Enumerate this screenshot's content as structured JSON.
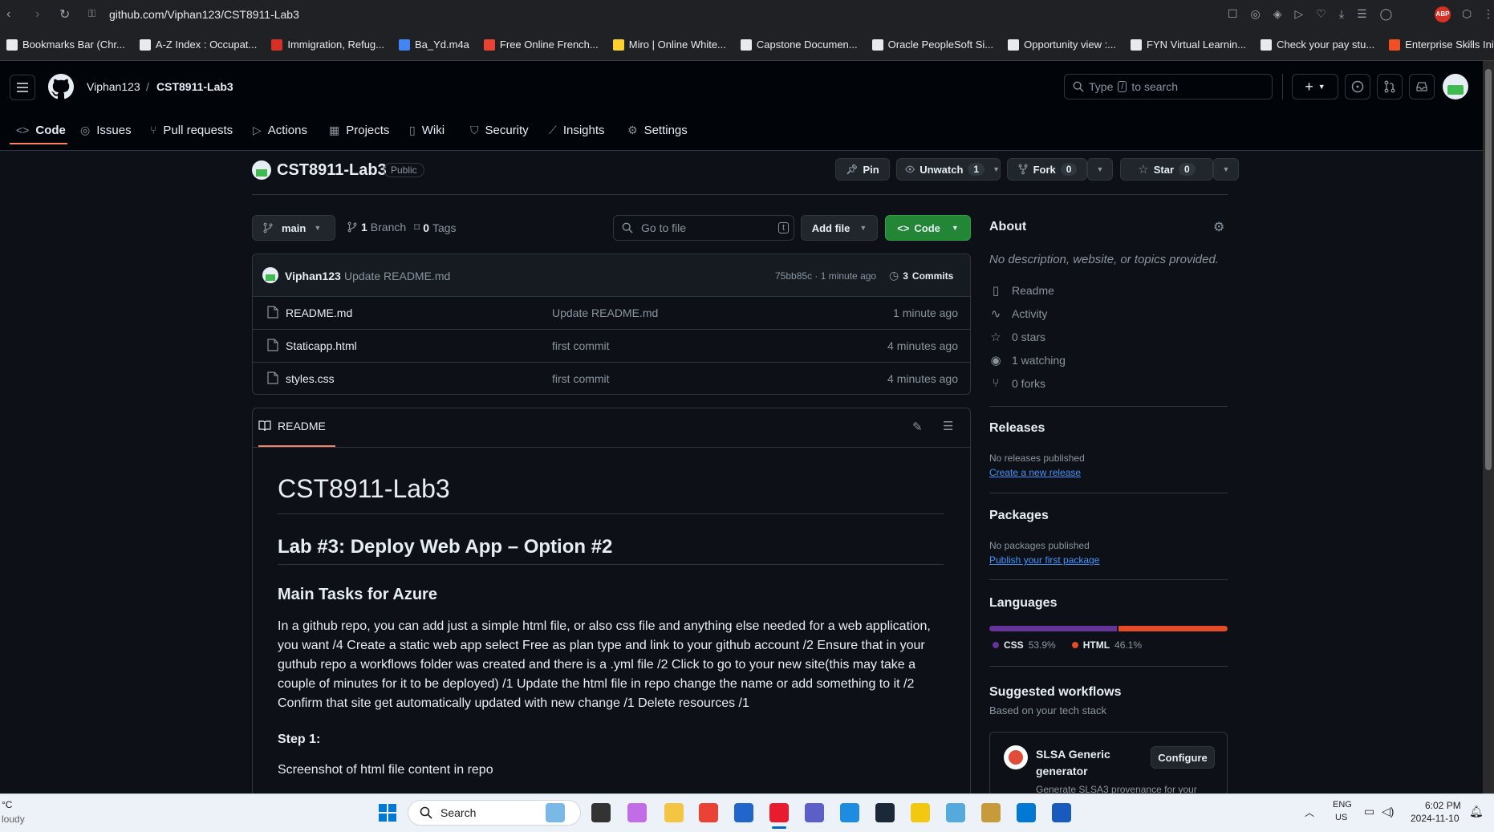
{
  "browser": {
    "url": "github.com/Viphan123/CST8911-Lab3",
    "bookmarks": [
      {
        "label": "Bookmarks Bar (Chr...",
        "color": "#e8eaed"
      },
      {
        "label": "A-Z Index : Occupat...",
        "color": "#e8eaed"
      },
      {
        "label": "Immigration, Refug...",
        "color": "#d93025"
      },
      {
        "label": "Ba_Yd.m4a",
        "color": "#4285f4"
      },
      {
        "label": "Free Online French...",
        "color": "#ea4335"
      },
      {
        "label": "Miro | Online White...",
        "color": "#ffd02f"
      },
      {
        "label": "Capstone Documen...",
        "color": "#e8eaed"
      },
      {
        "label": "Oracle PeopleSoft Si...",
        "color": "#e8eaed"
      },
      {
        "label": "Opportunity view :...",
        "color": "#e8eaed"
      },
      {
        "label": "FYN Virtual Learnin...",
        "color": "#e8eaed"
      },
      {
        "label": "Check your pay stu...",
        "color": "#e8eaed"
      },
      {
        "label": "Enterprise Skills Initi...",
        "color": "#f25022"
      }
    ]
  },
  "header": {
    "owner": "Viphan123",
    "separator": "/",
    "repo": "CST8911-Lab3",
    "search_placeholder_pre": "Type",
    "search_key": "/",
    "search_placeholder_post": "to search"
  },
  "tabs": [
    {
      "label": "Code",
      "icon": "code-icon"
    },
    {
      "label": "Issues",
      "icon": "issue-icon"
    },
    {
      "label": "Pull requests",
      "icon": "pull-request-icon"
    },
    {
      "label": "Actions",
      "icon": "play-icon"
    },
    {
      "label": "Projects",
      "icon": "table-icon"
    },
    {
      "label": "Wiki",
      "icon": "book-icon"
    },
    {
      "label": "Security",
      "icon": "shield-icon"
    },
    {
      "label": "Insights",
      "icon": "graph-icon"
    },
    {
      "label": "Settings",
      "icon": "gear-icon"
    }
  ],
  "repo": {
    "title": "CST8911-Lab3",
    "visibility": "Public",
    "pin": "Pin",
    "unwatch": "Unwatch",
    "watch_count": "1",
    "fork": "Fork",
    "fork_count": "0",
    "star": "Star",
    "star_count": "0"
  },
  "toolbar": {
    "branch": "main",
    "branches_count": "1",
    "branches_label": "Branch",
    "tags_count": "0",
    "tags_label": "Tags",
    "goto_placeholder": "Go to file",
    "goto_key": "t",
    "add_file": "Add file",
    "code": "Code"
  },
  "commit": {
    "author": "Viphan123",
    "message": "Update README.md",
    "hash_time": "75bb85c · 1 minute ago",
    "commits_count": "3",
    "commits_label": "Commits"
  },
  "files": [
    {
      "name": "README.md",
      "message": "Update README.md",
      "time": "1 minute ago"
    },
    {
      "name": "Staticapp.html",
      "message": "first commit",
      "time": "4 minutes ago"
    },
    {
      "name": "styles.css",
      "message": "first commit",
      "time": "4 minutes ago"
    }
  ],
  "readme": {
    "tab": "README",
    "h1": "CST8911-Lab3",
    "h2": "Lab #3: Deploy Web App – Option #2",
    "h3": "Main Tasks for Azure",
    "paragraph": "In a github repo, you can add just a simple html file, or also css file and anything else needed for a web application, you want /4 Create a static web app select Free as plan type and link to your github account /2 Ensure that in your guthub repo a workflows folder was created and there is a .yml file /2 Click to go to your new site(this may take a couple of minutes for it to be deployed) /1 Update the html file in repo change the name or add something to it /2 Confirm that site get automatically updated with new change /1 Delete resources /1",
    "step": "Step 1:",
    "step_text": "Screenshot of html file content in repo"
  },
  "about": {
    "title": "About",
    "description": "No description, website, or topics provided.",
    "links": [
      {
        "label": "Readme",
        "icon": "book-icon"
      },
      {
        "label": "Activity",
        "icon": "pulse-icon"
      },
      {
        "label": "0 stars",
        "icon": "star-icon"
      },
      {
        "label": "1 watching",
        "icon": "eye-icon"
      },
      {
        "label": "0 forks",
        "icon": "fork-icon"
      }
    ]
  },
  "releases": {
    "title": "Releases",
    "empty": "No releases published",
    "create": "Create a new release"
  },
  "packages": {
    "title": "Packages",
    "empty": "No packages published",
    "publish": "Publish your first package"
  },
  "languages": {
    "title": "Languages",
    "items": [
      {
        "name": "CSS",
        "percent": "53.9%",
        "fraction": 0.539,
        "color": "#663399"
      },
      {
        "name": "HTML",
        "percent": "46.1%",
        "fraction": 0.461,
        "color": "#e34c26"
      }
    ]
  },
  "workflows": {
    "title": "Suggested workflows",
    "subtitle": "Based on your tech stack",
    "card_title_1": "SLSA Generic",
    "card_title_2": "generator",
    "card_desc": "Generate SLSA3 provenance for your",
    "configure": "Configure"
  },
  "taskbar": {
    "weather_unit": "°C",
    "weather_text": "loudy",
    "search": "Search",
    "lang_1": "ENG",
    "lang_2": "US",
    "time": "6:02 PM",
    "date": "2024-11-10"
  }
}
